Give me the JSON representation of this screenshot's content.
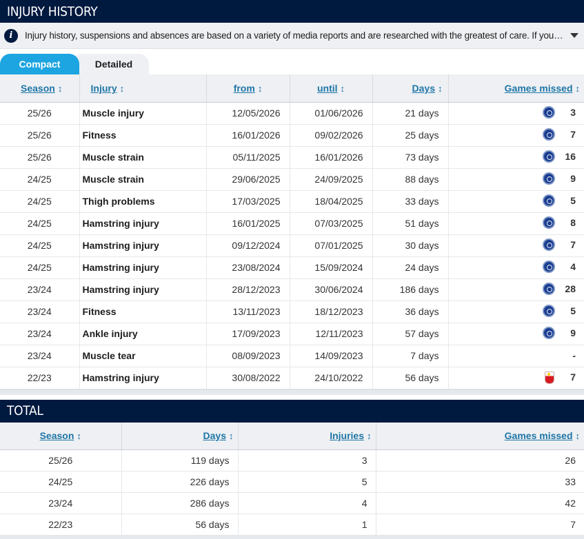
{
  "injury_section": {
    "title": "INJURY HISTORY",
    "notice": "Injury history, suspensions and absences are based on a variety of media reports and are researched with the greatest of care. If you should notice any errors, please contact us.",
    "tabs": {
      "compact": "Compact",
      "detailed": "Detailed"
    },
    "columns": {
      "season": "Season",
      "injury": "Injury",
      "from": "from",
      "until": "until",
      "days": "Days",
      "games_missed": "Games missed"
    },
    "rows": [
      {
        "season": "25/26",
        "injury": "Muscle injury",
        "from": "12/05/2026",
        "until": "01/06/2026",
        "days": "21 days",
        "club_icon": "chelsea-crest-icon",
        "games_missed": "3"
      },
      {
        "season": "25/26",
        "injury": "Fitness",
        "from": "16/01/2026",
        "until": "09/02/2026",
        "days": "25 days",
        "club_icon": "chelsea-crest-icon",
        "games_missed": "7"
      },
      {
        "season": "25/26",
        "injury": "Muscle strain",
        "from": "05/11/2025",
        "until": "16/01/2026",
        "days": "73 days",
        "club_icon": "chelsea-crest-icon",
        "games_missed": "16"
      },
      {
        "season": "24/25",
        "injury": "Muscle strain",
        "from": "29/06/2025",
        "until": "24/09/2025",
        "days": "88 days",
        "club_icon": "chelsea-crest-icon",
        "games_missed": "9"
      },
      {
        "season": "24/25",
        "injury": "Thigh problems",
        "from": "17/03/2025",
        "until": "18/04/2025",
        "days": "33 days",
        "club_icon": "chelsea-crest-icon",
        "games_missed": "5"
      },
      {
        "season": "24/25",
        "injury": "Hamstring injury",
        "from": "16/01/2025",
        "until": "07/03/2025",
        "days": "51 days",
        "club_icon": "chelsea-crest-icon",
        "games_missed": "8"
      },
      {
        "season": "24/25",
        "injury": "Hamstring injury",
        "from": "09/12/2024",
        "until": "07/01/2025",
        "days": "30 days",
        "club_icon": "chelsea-crest-icon",
        "games_missed": "7"
      },
      {
        "season": "24/25",
        "injury": "Hamstring injury",
        "from": "23/08/2024",
        "until": "15/09/2024",
        "days": "24 days",
        "club_icon": "chelsea-crest-icon",
        "games_missed": "4"
      },
      {
        "season": "23/24",
        "injury": "Hamstring injury",
        "from": "28/12/2023",
        "until": "30/06/2024",
        "days": "186 days",
        "club_icon": "chelsea-crest-icon",
        "games_missed": "28"
      },
      {
        "season": "23/24",
        "injury": "Fitness",
        "from": "13/11/2023",
        "until": "18/12/2023",
        "days": "36 days",
        "club_icon": "chelsea-crest-icon",
        "games_missed": "5"
      },
      {
        "season": "23/24",
        "injury": "Ankle injury",
        "from": "17/09/2023",
        "until": "12/11/2023",
        "days": "57 days",
        "club_icon": "chelsea-crest-icon",
        "games_missed": "9"
      },
      {
        "season": "23/24",
        "injury": "Muscle tear",
        "from": "08/09/2023",
        "until": "14/09/2023",
        "days": "7 days",
        "club_icon": "",
        "games_missed": "-"
      },
      {
        "season": "22/23",
        "injury": "Hamstring injury",
        "from": "30/08/2022",
        "until": "24/10/2022",
        "days": "56 days",
        "club_icon": "southampton-crest-icon",
        "games_missed": "7"
      }
    ]
  },
  "total_section": {
    "title": "TOTAL",
    "columns": {
      "season": "Season",
      "days": "Days",
      "injuries": "Injuries",
      "games_missed": "Games missed"
    },
    "rows": [
      {
        "season": "25/26",
        "days": "119 days",
        "injuries": "3",
        "games_missed": "26"
      },
      {
        "season": "24/25",
        "days": "226 days",
        "injuries": "5",
        "games_missed": "33"
      },
      {
        "season": "23/24",
        "days": "286 days",
        "injuries": "4",
        "games_missed": "42"
      },
      {
        "season": "22/23",
        "days": "56 days",
        "injuries": "1",
        "games_missed": "7"
      }
    ]
  },
  "icons": {
    "sort": "sort-arrows-icon",
    "info": "info-icon",
    "expand": "caret-down-icon"
  },
  "colors": {
    "header_bg": "#00193f",
    "tab_active": "#1ca5e0",
    "link": "#1d75a6"
  }
}
